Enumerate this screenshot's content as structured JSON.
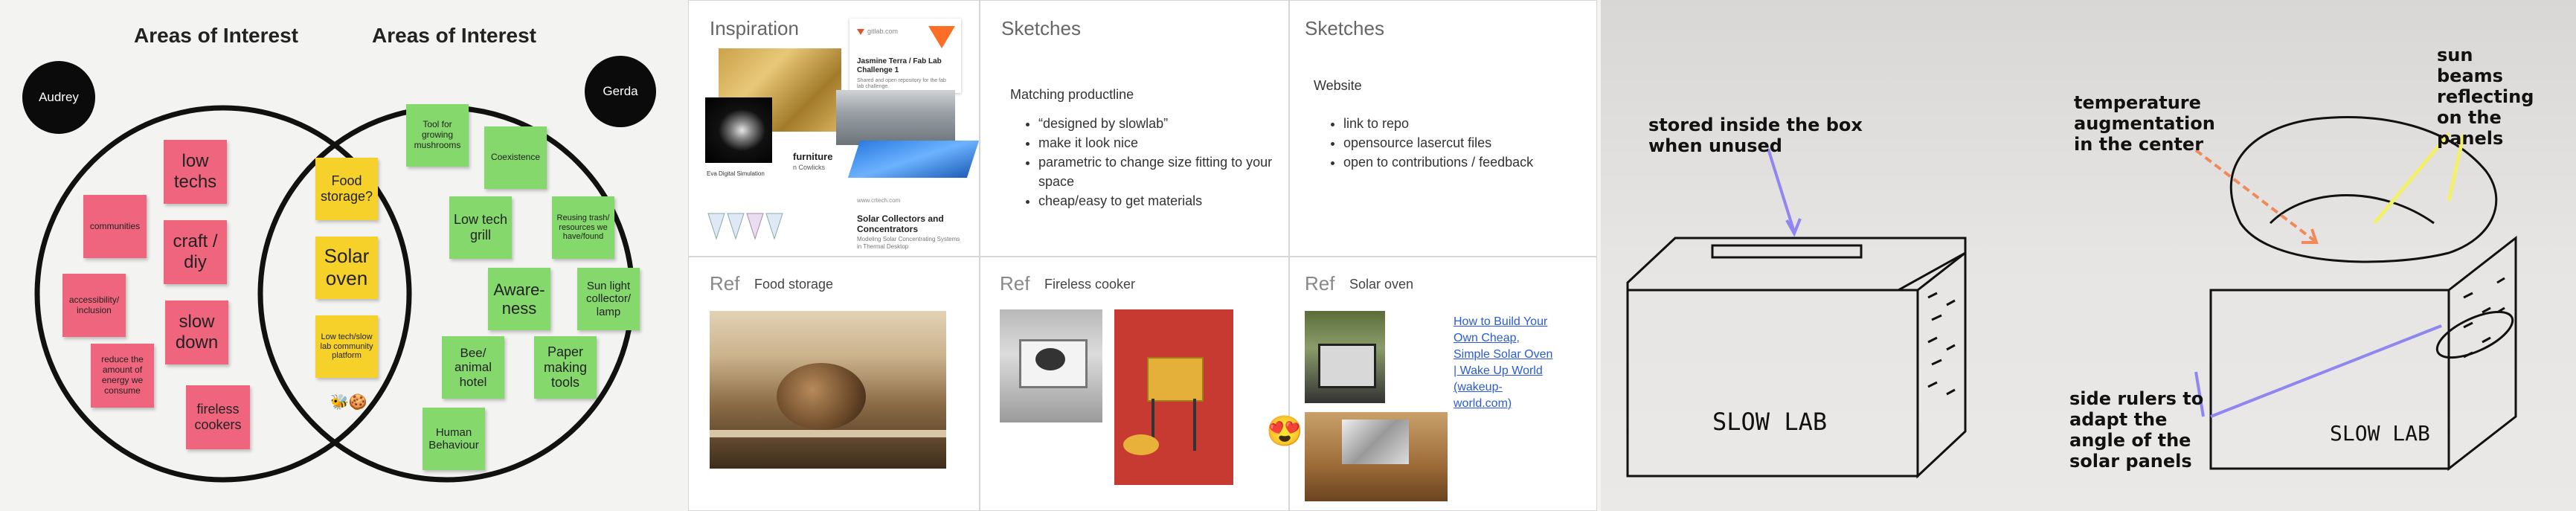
{
  "board": {
    "venn": {
      "title_left": "Areas of Interest",
      "title_right": "Areas of Interest",
      "avatar_left": "Audrey",
      "avatar_right": "Gerda",
      "left_notes": [
        "communities",
        "accessibility/ inclusion",
        "reduce the amount of energy we consume",
        "low techs",
        "craft / diy",
        "slow down",
        "fireless cookers"
      ],
      "middle_notes": [
        "Food storage?",
        "Solar oven",
        "Low tech/slow lab community platform"
      ],
      "right_notes": [
        "Tool for growing mushrooms",
        "Coexistence",
        "Low tech grill",
        "Reusing trash/ resources we have/found",
        "Aware- ness",
        "Sun light collector/ lamp",
        "Bee/ animal hotel",
        "Paper making tools",
        "Human Behaviour"
      ]
    },
    "inspiration": {
      "title": "Inspiration",
      "cards": [
        {
          "source": "gitlab.com",
          "title": "Jasmine Terra / Fab Lab Challenge 1",
          "desc": "Shared and open repository for the fab lab challenge"
        },
        {
          "title": "Solar Collectors and Concentrators",
          "desc": "Modeling Solar Concentrating Systems in Thermal Desktop",
          "source": "www.crtech.com"
        }
      ],
      "partial_text_1": "furniture",
      "partial_text_2": "n Cowlicks",
      "partial_text_3": "Eva Digital Simulation"
    },
    "sketches1": {
      "title": "Sketches",
      "heading": "Matching productline",
      "bullets": [
        "“designed by slowlab”",
        "make it look nice",
        "parametric to change size fitting to your space",
        "cheap/easy to get materials"
      ]
    },
    "sketches2": {
      "title": "Sketches",
      "heading": "Website",
      "bullets": [
        "link to repo",
        "opensource lasercut files",
        "open to contributions / feedback"
      ]
    },
    "ref1": {
      "label": "Ref",
      "title": "Food storage"
    },
    "ref2": {
      "label": "Ref",
      "title": "Fireless cooker"
    },
    "ref3": {
      "label": "Ref",
      "title": "Solar oven",
      "link": "How to Build Your Own Cheap, Simple Solar Oven | Wake Up World (wakeup-world.com)"
    },
    "sketch": {
      "note1": "stored inside the box when unused",
      "note2": "temperature augmentation in the center",
      "note3": "sun beams reflecting on the panels",
      "note4": "side rulers to adapt the angle of the solar panels",
      "box1_label": "SLOW LAB",
      "box2_label": "SLOW LAB"
    },
    "emoji": "😍",
    "colors": {
      "pink": "#f0657e",
      "yellow": "#f6d12a",
      "green": "#85d86b",
      "link": "#2a5bd7",
      "arrow_purple": "#8f86f0",
      "arrow_orange": "#f08a5a",
      "arrow_yellow": "#f2f06a"
    }
  }
}
